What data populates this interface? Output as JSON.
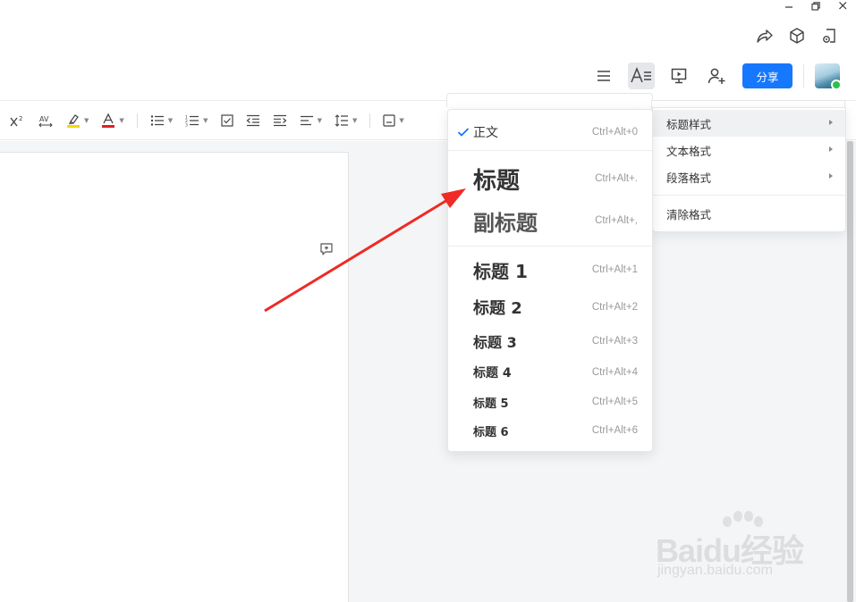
{
  "header": {
    "share_label": "分享"
  },
  "menu_styles": {
    "items": [
      {
        "label": "正文",
        "shortcut": "Ctrl+Alt+0",
        "checked": true
      },
      {
        "label": "标题",
        "shortcut": "Ctrl+Alt+."
      },
      {
        "label": "副标题",
        "shortcut": "Ctrl+Alt+,"
      },
      {
        "label": "标题 1",
        "shortcut": "Ctrl+Alt+1"
      },
      {
        "label": "标题 2",
        "shortcut": "Ctrl+Alt+2"
      },
      {
        "label": "标题 3",
        "shortcut": "Ctrl+Alt+3"
      },
      {
        "label": "标题 4",
        "shortcut": "Ctrl+Alt+4"
      },
      {
        "label": "标题 5",
        "shortcut": "Ctrl+Alt+5"
      },
      {
        "label": "标题 6",
        "shortcut": "Ctrl+Alt+6"
      }
    ]
  },
  "menu_format": {
    "items": [
      {
        "label": "标题样式",
        "active": true
      },
      {
        "label": "文本格式"
      },
      {
        "label": "段落格式"
      },
      {
        "label": "清除格式"
      }
    ]
  },
  "watermark": {
    "brand": "Baidu经验",
    "sub": "jingyan.baidu.com"
  },
  "colors": {
    "accent": "#1677ff",
    "arrow": "#ee2b24",
    "highlight": "#f5d800",
    "font_color": "#e02020"
  }
}
